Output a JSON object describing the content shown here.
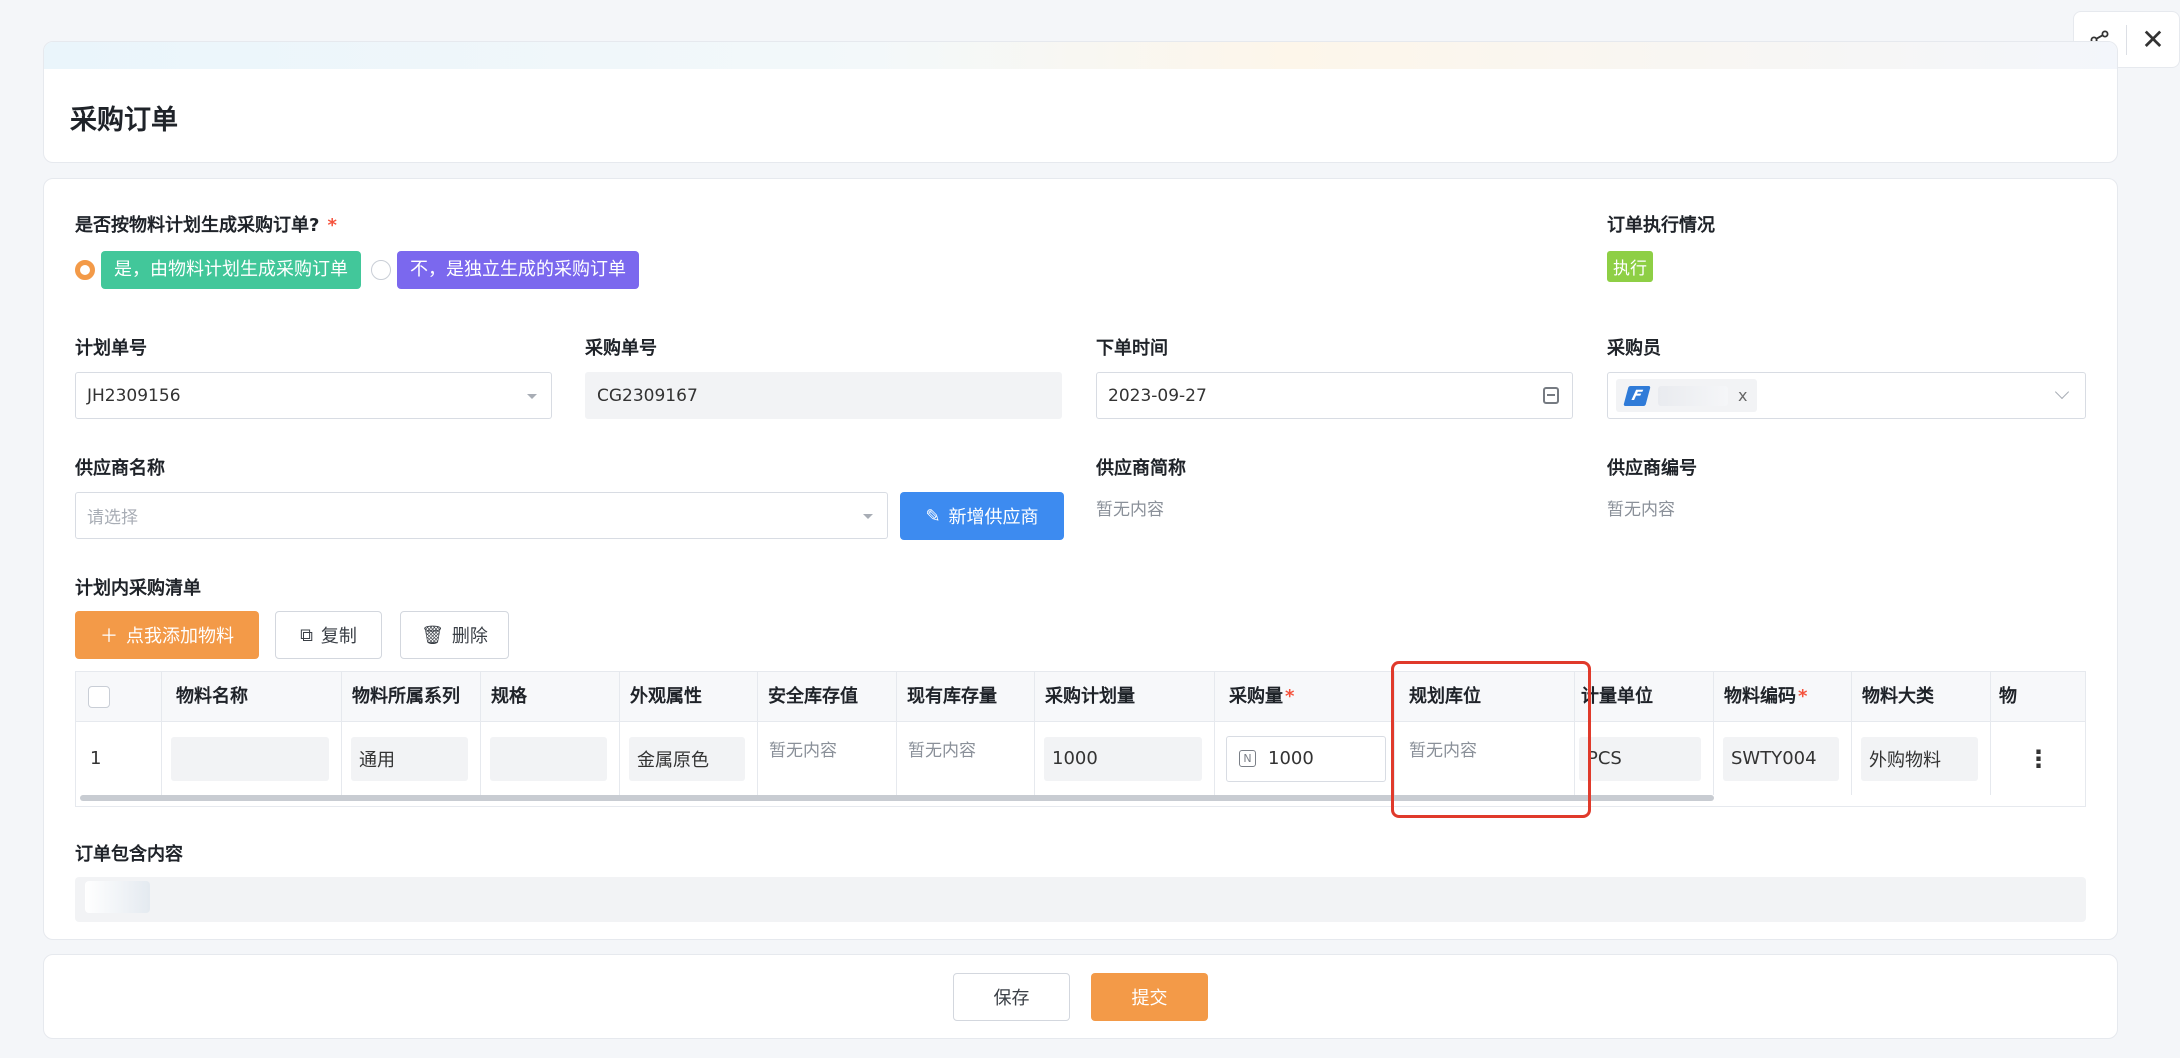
{
  "page_title": "采购订单",
  "form": {
    "question_label": "是否按物料计划生成采购订单?",
    "required_mark": "*",
    "radio_yes": "是，由物料计划生成采购订单",
    "radio_no": "不，是独立生成的采购订单",
    "exec_label": "订单执行情况",
    "exec_status": "执行",
    "plan_no_label": "计划单号",
    "plan_no_value": "JH2309156",
    "purchase_no_label": "采购单号",
    "purchase_no_value": "CG2309167",
    "order_time_label": "下单时间",
    "order_time_value": "2023-09-27",
    "buyer_label": "采购员",
    "buyer_remove": "x",
    "supplier_name_label": "供应商名称",
    "supplier_placeholder": "请选择",
    "add_supplier_button": "新增供应商",
    "supplier_short_label": "供应商简称",
    "supplier_short_value": "暂无内容",
    "supplier_code_label": "供应商编号",
    "supplier_code_value": "暂无内容"
  },
  "list": {
    "title": "计划内采购清单",
    "add_button": "点我添加物料",
    "copy_button": "复制",
    "delete_button": "删除",
    "headers": {
      "name": "物料名称",
      "series": "物料所属系列",
      "spec": "规格",
      "appearance": "外观属性",
      "safety_stock": "安全库存值",
      "current_stock": "现有库存量",
      "plan_qty": "采购计划量",
      "purchase_qty": "采购量",
      "location": "规划库位",
      "unit": "计量单位",
      "code": "物料编码",
      "category": "物料大类",
      "more": "物"
    },
    "rows": [
      {
        "index": "1",
        "series": "通用",
        "appearance": "金属原色",
        "safety_stock": "暂无内容",
        "current_stock": "暂无内容",
        "plan_qty": "1000",
        "purchase_qty": "1000",
        "location": "暂无内容",
        "unit": "PCS",
        "code": "SWTY004",
        "category": "外购物料"
      }
    ]
  },
  "order_content_label": "订单包含内容",
  "footer": {
    "save_button": "保存",
    "submit_button": "提交"
  },
  "colors": {
    "accent_orange": "#f39a48",
    "accent_blue": "#3d8bf0",
    "highlight_red": "#e03a2b"
  }
}
